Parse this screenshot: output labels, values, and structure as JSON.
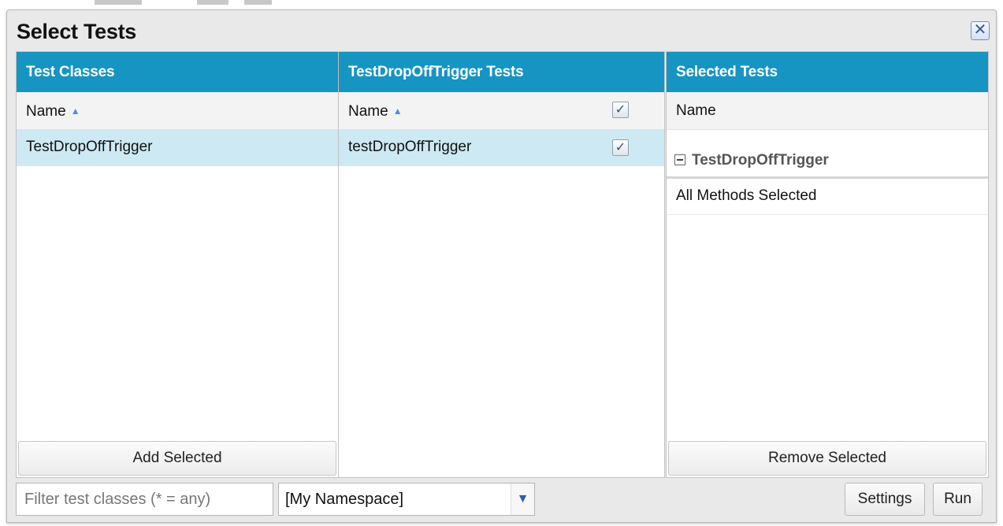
{
  "dialog": {
    "title": "Select Tests",
    "close_glyph": "✕"
  },
  "classes_panel": {
    "header": "Test Classes",
    "column": "Name",
    "rows": [
      "TestDropOffTrigger"
    ],
    "button": "Add Selected"
  },
  "tests_panel": {
    "header": "TestDropOffTrigger Tests",
    "column": "Name",
    "rows": [
      "testDropOffTrigger"
    ]
  },
  "selected_panel": {
    "header": "Selected Tests",
    "column": "Name",
    "group": "TestDropOffTrigger",
    "group_detail": "All Methods Selected",
    "button": "Remove Selected"
  },
  "bottom": {
    "filter_placeholder": "Filter test classes (* = any)",
    "namespace_value": "[My Namespace]",
    "settings": "Settings",
    "run": "Run"
  },
  "colors": {
    "header_bg": "#1694c2",
    "selected_row": "#cde9f3"
  }
}
